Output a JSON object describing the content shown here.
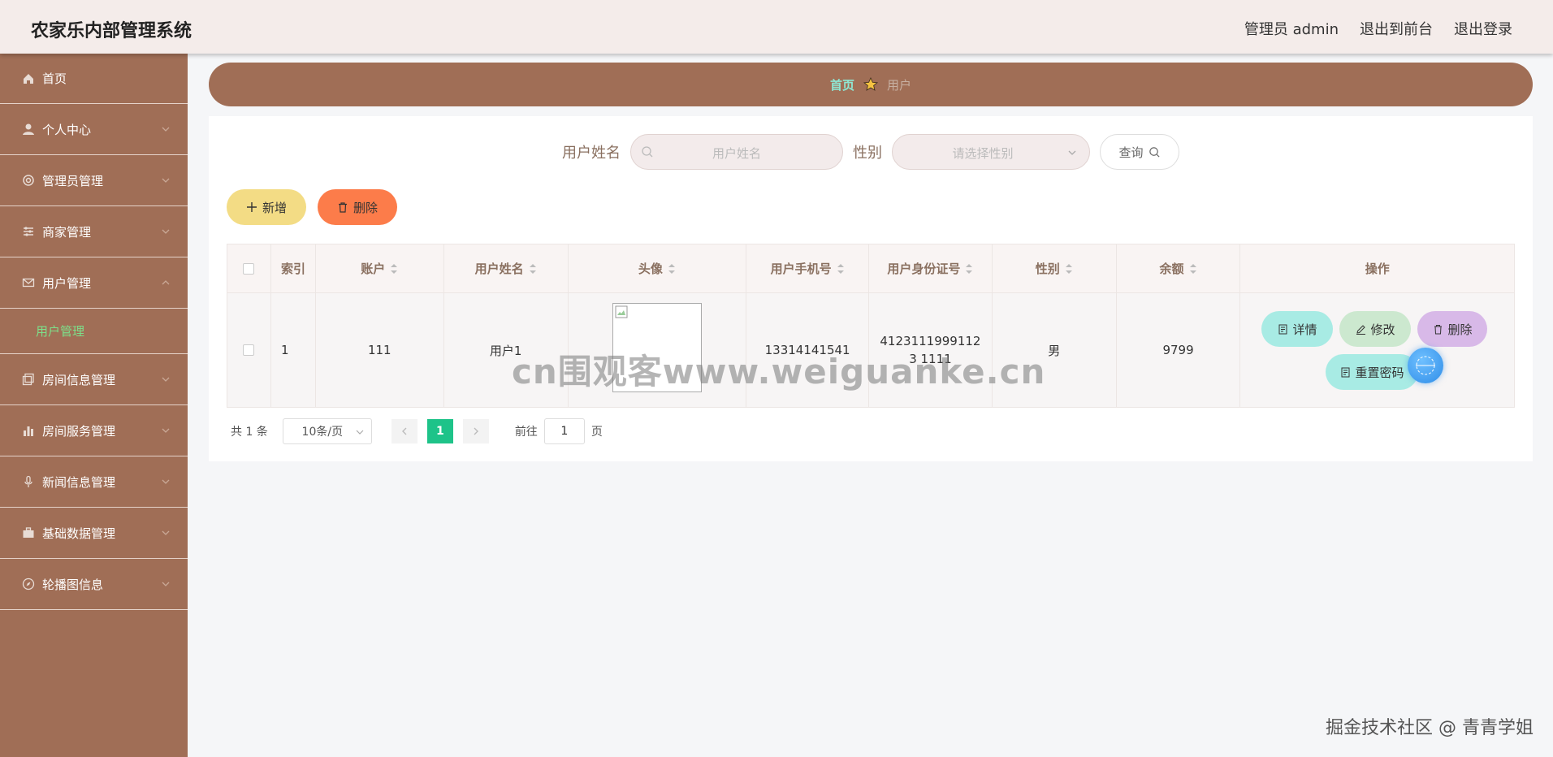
{
  "header": {
    "title": "农家乐内部管理系统",
    "links": [
      "管理员 admin",
      "退出到前台",
      "退出登录"
    ]
  },
  "sidebar": {
    "items": [
      {
        "label": "首页",
        "icon": "home-icon"
      },
      {
        "label": "个人中心",
        "icon": "user-icon"
      },
      {
        "label": "管理员管理",
        "icon": "settings-icon"
      },
      {
        "label": "商家管理",
        "icon": "sliders-icon"
      },
      {
        "label": "用户管理",
        "icon": "mail-icon",
        "expanded": true
      },
      {
        "label": "房间信息管理",
        "icon": "copy-icon"
      },
      {
        "label": "房间服务管理",
        "icon": "chart-icon"
      },
      {
        "label": "新闻信息管理",
        "icon": "mic-icon"
      },
      {
        "label": "基础数据管理",
        "icon": "briefcase-icon"
      },
      {
        "label": "轮播图信息",
        "icon": "compass-icon"
      }
    ],
    "sub_item": "用户管理"
  },
  "breadcrumb": {
    "home": "首页",
    "current": "用户"
  },
  "search": {
    "name_label": "用户姓名",
    "name_placeholder": "用户姓名",
    "gender_label": "性别",
    "gender_placeholder": "请选择性别",
    "query_label": "查询"
  },
  "actions": {
    "add": "新增",
    "delete": "删除"
  },
  "table": {
    "headers": [
      "索引",
      "账户",
      "用户姓名",
      "头像",
      "用户手机号",
      "用户身份证号",
      "性别",
      "余额",
      "操作"
    ],
    "rows": [
      {
        "index": "1",
        "account": "111",
        "name": "用户1",
        "phone": "13314141541",
        "id_card": "41231119991123 1111",
        "gender": "男",
        "balance": "9799"
      }
    ],
    "ops": {
      "detail": "详情",
      "edit": "修改",
      "delete": "删除",
      "reset": "重置密码"
    }
  },
  "pagination": {
    "total": "共 1 条",
    "page_size": "10条/页",
    "current": "1",
    "goto_prefix": "前往",
    "goto_value": "1",
    "goto_suffix": "页"
  },
  "watermark": "cn围观客www.weiguanke.cn",
  "credit": "掘金技术社区 @ 青青学姐",
  "colors": {
    "sidebar": "#a06e56",
    "accent_green": "#1ec389",
    "header_bg": "#f4ecea"
  }
}
